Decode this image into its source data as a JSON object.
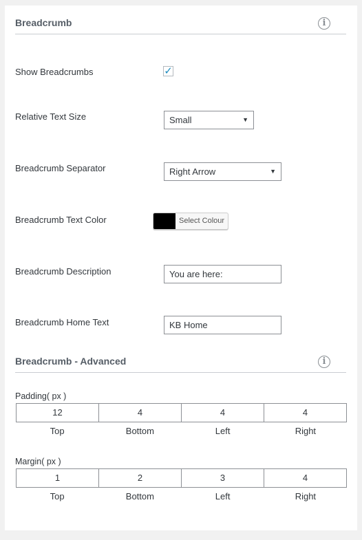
{
  "breadcrumb": {
    "title": "Breadcrumb",
    "show_label": "Show Breadcrumbs",
    "show_checked": true,
    "text_size_label": "Relative Text Size",
    "text_size_value": "Small",
    "separator_label": "Breadcrumb Separator",
    "separator_value": "Right Arrow",
    "text_color_label": "Breadcrumb Text Color",
    "text_color_value": "#000000",
    "select_colour_label": "Select Colour",
    "description_label": "Breadcrumb Description",
    "description_value": "You are here:",
    "home_text_label": "Breadcrumb Home Text",
    "home_text_value": "KB Home"
  },
  "advanced": {
    "title": "Breadcrumb - Advanced",
    "padding": {
      "label": "Padding( px )",
      "values": [
        "12",
        "4",
        "4",
        "4"
      ],
      "captions": [
        "Top",
        "Bottom",
        "Left",
        "Right"
      ]
    },
    "margin": {
      "label": "Margin( px )",
      "values": [
        "1",
        "2",
        "3",
        "4"
      ],
      "captions": [
        "Top",
        "Bottom",
        "Left",
        "Right"
      ]
    }
  },
  "icons": {
    "info": "info-icon",
    "checkmark": "checkmark-icon",
    "dropdown": "dropdown-arrow-icon"
  }
}
